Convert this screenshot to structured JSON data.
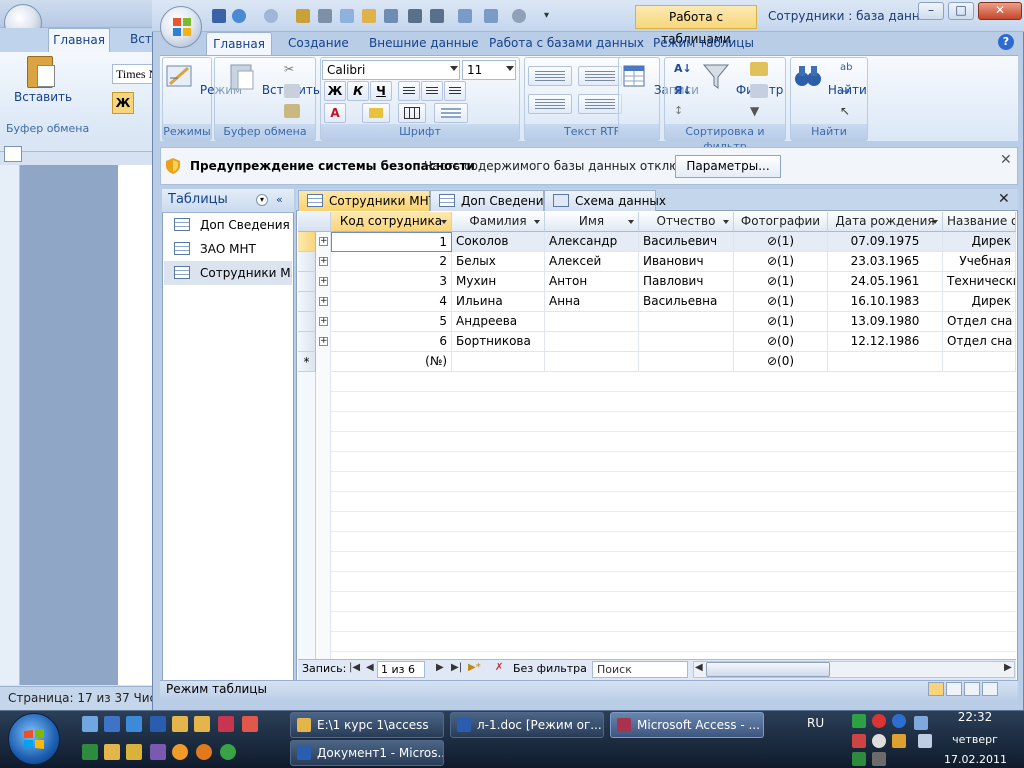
{
  "word": {
    "tab_home": "Главная",
    "tab_insert": "Вста",
    "paste_label": "Вставить",
    "clipboard_group": "Буфер обмена",
    "font_name": "Times N",
    "bold": "Ж",
    "status": "Страница: 17 из 37   Числ"
  },
  "access": {
    "context_tab": "Работа с таблицами",
    "title": "Сотрудники : база данн...",
    "window_buttons": {
      "minimize": "–",
      "maximize": "□",
      "close": "✕"
    },
    "ribbon_tabs": [
      "Главная",
      "Создание",
      "Внешние данные",
      "Работа с базами данных",
      "Режим таблицы"
    ],
    "groups": {
      "views": {
        "label": "Режимы",
        "button": "Режим"
      },
      "clipboard": {
        "label": "Буфер обмена",
        "button": "Вставить"
      },
      "font": {
        "label": "Шрифт",
        "font_name": "Calibri",
        "font_size": "11",
        "bold": "Ж",
        "italic": "К",
        "underline": "Ч"
      },
      "rtf": {
        "label": "Текст RTF"
      },
      "records": {
        "label": "Записи",
        "button": "Записи"
      },
      "sort_filter": {
        "label": "Сортировка и фильтр",
        "button": "Фильтр"
      },
      "find": {
        "label": "Найти",
        "button": "Найти"
      }
    },
    "security": {
      "title": "Предупреждение системы безопасности",
      "message": "Часть содержимого базы данных отключено",
      "button": "Параметры..."
    },
    "nav_pane": {
      "title": "Таблицы",
      "items": [
        "Доп Сведения",
        "ЗАО МНТ",
        "Сотрудники М..."
      ]
    },
    "doc_tabs": [
      "Сотрудники МНТ",
      "Доп Сведения",
      "Схема данных"
    ],
    "grid": {
      "headers": [
        "Код сотрудника",
        "Фамилия",
        "Имя",
        "Отчество",
        "Фотографии",
        "Дата рождения",
        "Название о"
      ],
      "rows": [
        [
          "1",
          "Соколов",
          "Александр",
          "Васильевич",
          "(1)",
          "07.09.1975",
          "Дирек"
        ],
        [
          "2",
          "Белых",
          "Алексей",
          "Иванович",
          "(1)",
          "23.03.1965",
          "Учебная"
        ],
        [
          "3",
          "Мухин",
          "Антон",
          "Павлович",
          "(1)",
          "24.05.1961",
          "Технически"
        ],
        [
          "4",
          "Ильина",
          "Анна",
          "Васильевна",
          "(1)",
          "16.10.1983",
          "Дирек"
        ],
        [
          "5",
          "Андреева",
          "",
          "",
          "(1)",
          "13.09.1980",
          "Отдел сна"
        ],
        [
          "6",
          "Бортникова",
          "",
          "",
          "(0)",
          "12.12.1986",
          "Отдел сна"
        ]
      ],
      "new_row": {
        "marker": "*",
        "id": "(№)",
        "photo": "(0)"
      }
    },
    "record_nav": {
      "label": "Запись:",
      "position": "1 из 6",
      "filter": "Без фильтра",
      "search": "Поиск"
    },
    "status": "Режим таблицы"
  },
  "taskbar": {
    "buttons": [
      {
        "label": "E:\\1 курс 1\\access"
      },
      {
        "label": "л-1.doc [Режим ог..."
      },
      {
        "label": "Microsoft Access - ..."
      },
      {
        "label": "Документ1 - Micros..."
      }
    ],
    "lang": "RU",
    "time": "22:32",
    "day": "четверг",
    "date": "17.02.2011"
  },
  "colors": {
    "ribbon_blue": "#15428b",
    "selected_tab": "#f9d270",
    "taskbar": "#1b2a40"
  }
}
